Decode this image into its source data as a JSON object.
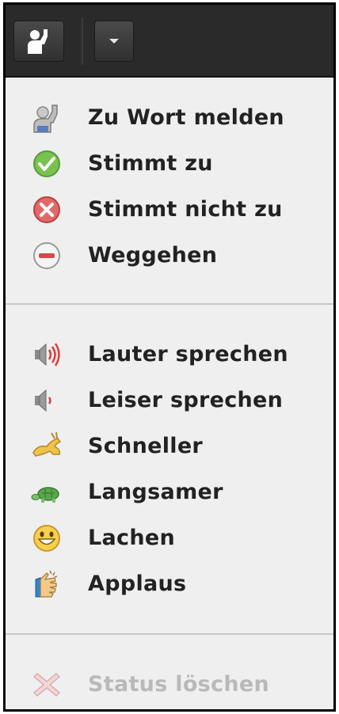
{
  "toolbar": {
    "status_icon": "raise-hand-person-icon",
    "dropdown_icon": "chevron-down-icon"
  },
  "menu": {
    "group1": [
      {
        "label": "Zu Wort melden",
        "icon": "raise-hand-icon"
      },
      {
        "label": "Stimmt zu",
        "icon": "check-circle-icon"
      },
      {
        "label": "Stimmt nicht zu",
        "icon": "x-circle-icon"
      },
      {
        "label": "Weggehen",
        "icon": "minus-circle-icon"
      }
    ],
    "group2": [
      {
        "label": "Lauter sprechen",
        "icon": "speaker-loud-icon"
      },
      {
        "label": "Leiser sprechen",
        "icon": "speaker-quiet-icon"
      },
      {
        "label": "Schneller",
        "icon": "rabbit-icon"
      },
      {
        "label": "Langsamer",
        "icon": "turtle-icon"
      },
      {
        "label": "Lachen",
        "icon": "smiley-icon"
      },
      {
        "label": "Applaus",
        "icon": "applause-icon"
      }
    ],
    "group3": [
      {
        "label": "Status löschen",
        "icon": "clear-x-icon",
        "disabled": true
      }
    ]
  },
  "colors": {
    "toolbar_bg": "#2a2a2a",
    "menu_bg": "#efefef",
    "text": "#222222",
    "disabled_text": "#b9b9b9",
    "agree_green": "#6fc04a",
    "disagree_red": "#d9534f"
  }
}
